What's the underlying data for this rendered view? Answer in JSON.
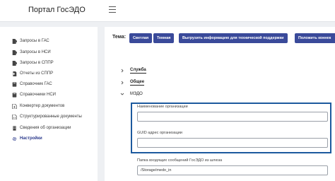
{
  "header": {
    "title": "Портал ГосЭДО"
  },
  "sidebar": {
    "items": [
      {
        "label": "Запросы в ГАС",
        "icon": "file-export-icon"
      },
      {
        "label": "Запросы в НСИ",
        "icon": "file-export-icon"
      },
      {
        "label": "Запросы в СППР",
        "icon": "file-export-icon"
      },
      {
        "label": "Отчеты из СППР",
        "icon": "file-import-icon"
      },
      {
        "label": "Справочник ГАС",
        "icon": "book-icon"
      },
      {
        "label": "Справочники НСИ",
        "icon": "book-icon"
      },
      {
        "label": "Конвертер документов",
        "icon": "file-convert-icon"
      },
      {
        "label": "Структурированные документы",
        "icon": "file-code-icon"
      },
      {
        "label": "Сведения об организации",
        "icon": "building-icon"
      },
      {
        "label": "Настройки",
        "icon": "gear-icon"
      }
    ]
  },
  "toolbar": {
    "theme_label": "Тема:",
    "light_theme": "Светлая",
    "dark_theme": "Темная",
    "download_info": "Выгрузить информацию для технической поддержки",
    "put_connector": "Положить коннек"
  },
  "sections": {
    "service": "Служба",
    "general": "Общее",
    "medo": "МЭДО"
  },
  "medo": {
    "org_name_label": "Наименование организации",
    "org_name_value": "",
    "guid_label": "GUID адрес организации",
    "guid_value": "",
    "inbox_label": "Папка входящих сообщений ГосЭДО из шлюза",
    "inbox_value": "/Storage/medo_in"
  },
  "colors": {
    "accent": "#3a4a9a",
    "highlight_border": "#1d5a9e",
    "active_nav": "#2b3a8c"
  }
}
